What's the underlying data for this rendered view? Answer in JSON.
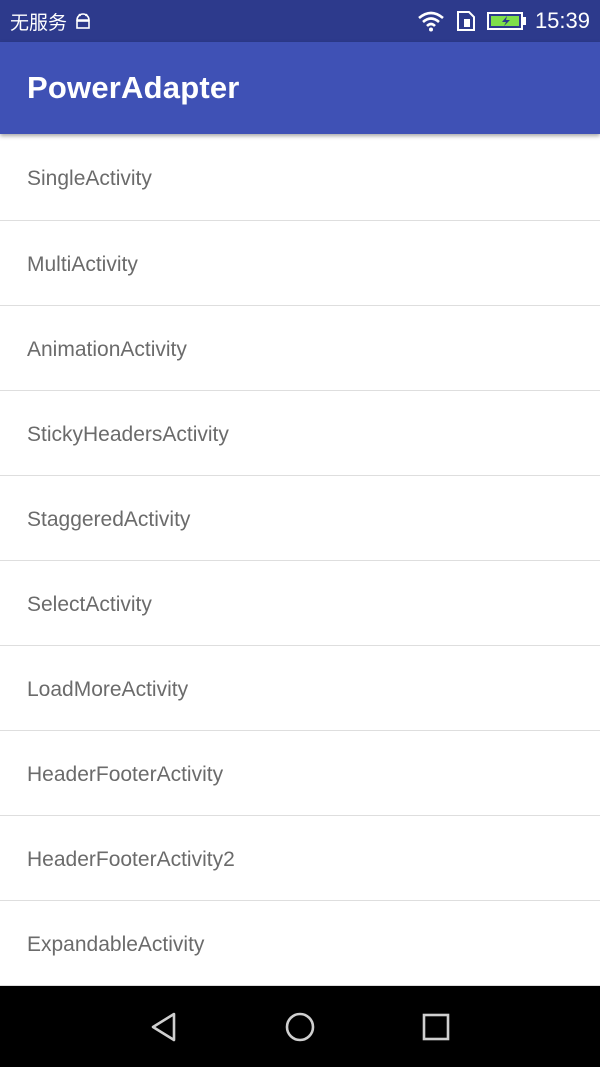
{
  "status_bar": {
    "carrier_text": "无服务",
    "time": "15:39",
    "icons": [
      "android-notification-icon",
      "wifi-icon",
      "sim-card-icon",
      "battery-charging-icon"
    ]
  },
  "app_bar": {
    "title": "PowerAdapter",
    "color": "#3f51b5",
    "status_color": "#2d3a8c"
  },
  "list": {
    "items": [
      {
        "label": "SingleActivity"
      },
      {
        "label": "MultiActivity"
      },
      {
        "label": "AnimationActivity"
      },
      {
        "label": "StickyHeadersActivity"
      },
      {
        "label": "StaggeredActivity"
      },
      {
        "label": "SelectActivity"
      },
      {
        "label": "LoadMoreActivity"
      },
      {
        "label": "HeaderFooterActivity"
      },
      {
        "label": "HeaderFooterActivity2"
      },
      {
        "label": "ExpandableActivity"
      }
    ]
  },
  "nav_bar": {
    "buttons": [
      "back-icon",
      "home-icon",
      "recents-icon"
    ]
  }
}
